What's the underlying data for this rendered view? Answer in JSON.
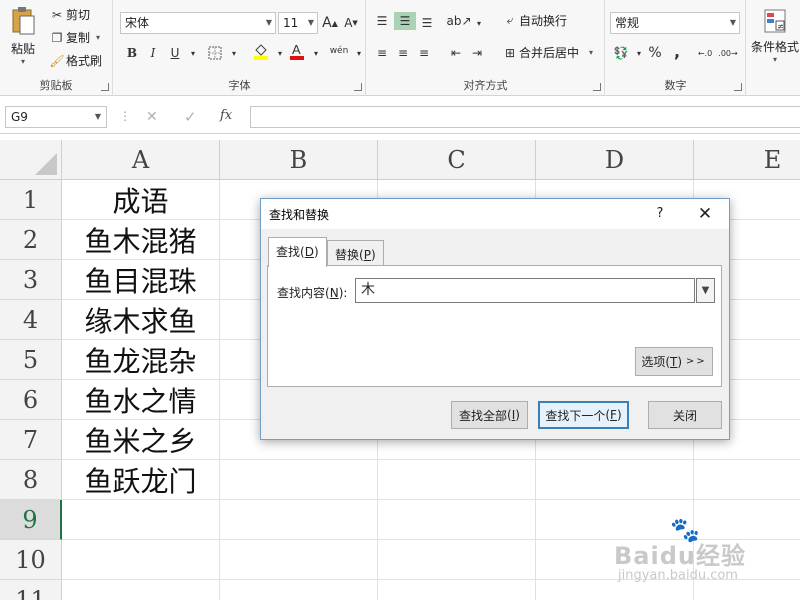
{
  "ribbon": {
    "clipboard": {
      "group_label": "剪贴板",
      "paste": "粘贴",
      "cut": "剪切",
      "copy": "复制",
      "format_painter": "格式刷"
    },
    "font": {
      "group_label": "字体",
      "font_name": "宋体",
      "font_size": "11",
      "bold": "B",
      "italic": "I",
      "underline": "U",
      "grow": "A",
      "shrink": "A",
      "phonetic": "wén"
    },
    "alignment": {
      "group_label": "对齐方式",
      "wrap_text": "自动换行",
      "merge_center": "合并后居中"
    },
    "number": {
      "group_label": "数字",
      "format": "常规",
      "percent": "%",
      "comma": ",",
      "inc_decimal": "←.0",
      "dec_decimal": ".00→"
    },
    "styles": {
      "conditional_format": "条件格式"
    }
  },
  "formula_bar": {
    "name_box": "G9",
    "cancel": "✕",
    "enter": "✓",
    "fx": "fx",
    "value": ""
  },
  "sheet": {
    "columns": [
      "A",
      "B",
      "C",
      "D",
      "E"
    ],
    "rows": [
      "1",
      "2",
      "3",
      "4",
      "5",
      "6",
      "7",
      "8",
      "9",
      "10",
      "11"
    ],
    "active_row": "9",
    "column_a": [
      "成语",
      "鱼木混猪",
      "鱼目混珠",
      "缘木求鱼",
      "鱼龙混杂",
      "鱼水之情",
      "鱼米之乡",
      "鱼跃龙门"
    ]
  },
  "dialog": {
    "title": "查找和替换",
    "help": "?",
    "close": "✕",
    "tabs": [
      {
        "label": "查找",
        "accel": "D"
      },
      {
        "label": "替换",
        "accel": "P"
      }
    ],
    "find_label": "查找内容",
    "find_accel": "N",
    "find_value": "木",
    "options": {
      "label": "选项",
      "accel": "T",
      "suffix": ">>"
    },
    "find_all": {
      "label": "查找全部",
      "accel": "I"
    },
    "find_next": {
      "label": "查找下一个",
      "accel": "F"
    },
    "close_button": "关闭"
  },
  "watermark": {
    "text": "Baidu经验",
    "url": "jingyan.baidu.com"
  }
}
